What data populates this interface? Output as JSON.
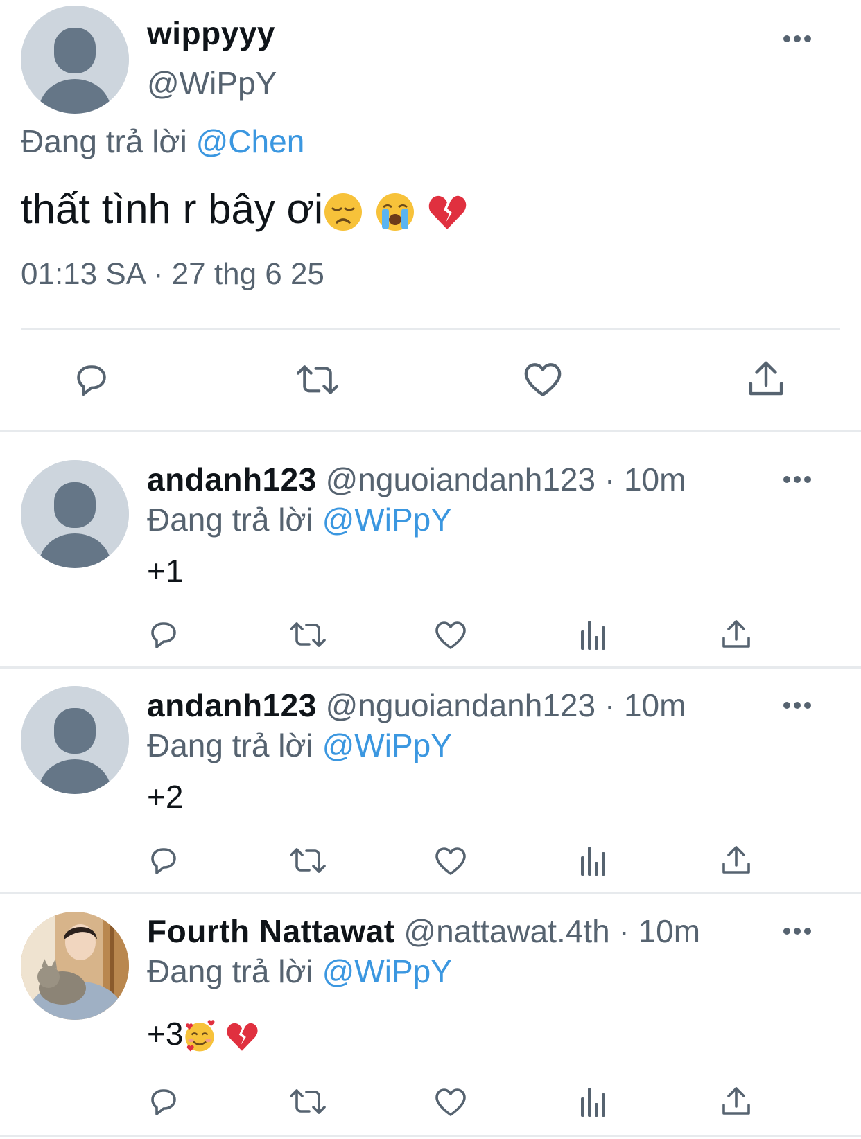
{
  "main_tweet": {
    "display_name": "wippyyy",
    "handle": "@WiPpY",
    "reply_prefix": "Đang trả lời",
    "reply_to": "@Chen",
    "text": "thất tình r bây ơi",
    "emojis": [
      "disappointed-face",
      "loudly-crying-face",
      "broken-heart"
    ],
    "timestamp": "01:13 SA · 27 thg 6 25"
  },
  "replies": [
    {
      "display_name": "andanh123",
      "handle_time": "@nguoiandanh123 · 10m",
      "reply_prefix": "Đang trả lời",
      "reply_to": "@WiPpY",
      "text": "+1"
    },
    {
      "display_name": "andanh123",
      "handle_time": "@nguoiandanh123 · 10m",
      "reply_prefix": "Đang trả lời",
      "reply_to": "@WiPpY",
      "text": "+2"
    },
    {
      "display_name": "Fourth Nattawat",
      "handle_time": "@nattawat.4th · 10m",
      "reply_prefix": "Đang trả lời",
      "reply_to": "@WiPpY",
      "text": "+3",
      "emojis": [
        "smiling-face-with-hearts",
        "broken-heart"
      ]
    }
  ],
  "colors": {
    "link": "#3b97e0",
    "muted": "#566370",
    "icon": "#566370",
    "divider": "#e7eaed",
    "avatar_bg": "#cdd5dd",
    "avatar_fg": "#657687"
  }
}
